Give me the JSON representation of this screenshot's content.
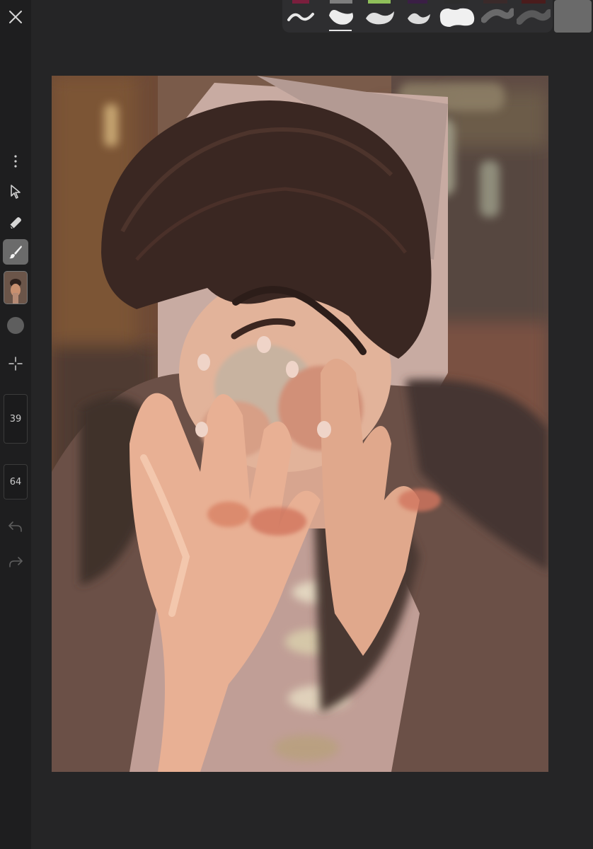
{
  "toolbar": {
    "brush_size": "39",
    "brush_opacity": "64",
    "tools": [
      "close-icon",
      "more-vertical-icon",
      "select-arrow-icon",
      "eraser-icon",
      "brush-icon",
      "layer-thumbnail",
      "color-picker",
      "transform-move-icon",
      "undo-icon",
      "redo-icon"
    ]
  },
  "palette": {
    "swatches": [
      "#7a1f3d",
      "#7e7e7e",
      "#8fbf5a",
      "#3a1f45",
      "#2d2d2d",
      "#3a2a2a",
      "#4a1c1c"
    ],
    "selected_brush_index": 1,
    "active_color": "#6a6a6a"
  },
  "canvas": {
    "background": "#7a5b49"
  }
}
